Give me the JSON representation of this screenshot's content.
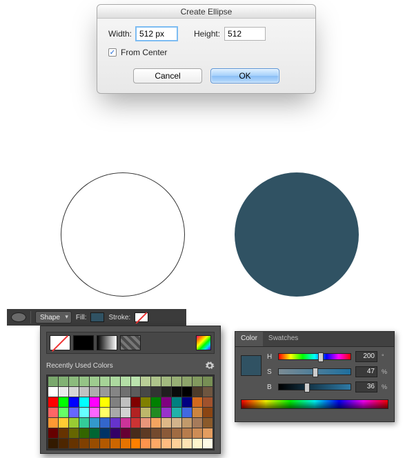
{
  "dialog": {
    "title": "Create Ellipse",
    "width_label": "Width:",
    "width_value": "512 px",
    "height_label": "Height:",
    "height_value": "512",
    "from_center_label": "From Center",
    "from_center_checked": true,
    "cancel": "Cancel",
    "ok": "OK"
  },
  "circles": {
    "fill_hex": "#305263"
  },
  "toolbar": {
    "shape_mode": "Shape",
    "fill_label": "Fill:",
    "stroke_label": "Stroke:"
  },
  "fill_popover": {
    "section_label": "Recently Used Colors",
    "swatches": [
      "#7aa86d",
      "#82b274",
      "#8cbb7d",
      "#95c486",
      "#9ecc8f",
      "#a6d397",
      "#add99f",
      "#b4dfa6",
      "#bbe4ae",
      "#b9ce97",
      "#aec48b",
      "#a3ba80",
      "#98af75",
      "#8da46a",
      "#829a5f",
      "#778f55",
      "#ffffff",
      "#ebebeb",
      "#d6d6d6",
      "#c2c2c2",
      "#adadad",
      "#999999",
      "#858585",
      "#707070",
      "#5c5c5c",
      "#474747",
      "#333333",
      "#1f1f1f",
      "#0a0a0a",
      "#000000",
      "#4d3b2a",
      "#6e5640",
      "#ff0000",
      "#00ff00",
      "#0000ff",
      "#00ffff",
      "#ff00ff",
      "#ffff00",
      "#808080",
      "#c0c0c0",
      "#800000",
      "#808000",
      "#008000",
      "#800080",
      "#008080",
      "#000080",
      "#d2691e",
      "#a0522d",
      "#ff6666",
      "#66ff66",
      "#6666ff",
      "#66ffff",
      "#ff66ff",
      "#ffff66",
      "#a9a9a9",
      "#d3d3d3",
      "#b22222",
      "#bdb76b",
      "#228b22",
      "#9932cc",
      "#20b2aa",
      "#4169e1",
      "#cd853f",
      "#8b4513",
      "#ff9933",
      "#ffcc33",
      "#99cc33",
      "#33cc99",
      "#3399cc",
      "#3366cc",
      "#6633cc",
      "#cc3399",
      "#cc3333",
      "#e9967a",
      "#f4a460",
      "#deb887",
      "#d2b48c",
      "#c19a6b",
      "#a67b5b",
      "#8b5a2b",
      "#660000",
      "#663300",
      "#666600",
      "#336600",
      "#006633",
      "#003366",
      "#330066",
      "#660033",
      "#472c1b",
      "#5d3a24",
      "#734a2e",
      "#8a5a38",
      "#a06b42",
      "#b77c4c",
      "#cd8c56",
      "#e49d60",
      "#331a00",
      "#4d2600",
      "#663300",
      "#804000",
      "#994d00",
      "#b35900",
      "#cc6600",
      "#e67300",
      "#ff8000",
      "#ff944d",
      "#ffa866",
      "#ffbb80",
      "#ffcf99",
      "#ffe2b3",
      "#fff5cc",
      "#fffbe6"
    ]
  },
  "color_panel": {
    "tab_color": "Color",
    "tab_swatches": "Swatches",
    "h": {
      "label": "H",
      "value": "200",
      "unit": "°",
      "pos": 55
    },
    "s": {
      "label": "S",
      "value": "47",
      "unit": "%",
      "pos": 47
    },
    "b": {
      "label": "B",
      "value": "36",
      "unit": "%",
      "pos": 36
    },
    "swatch_hex": "#305263"
  }
}
